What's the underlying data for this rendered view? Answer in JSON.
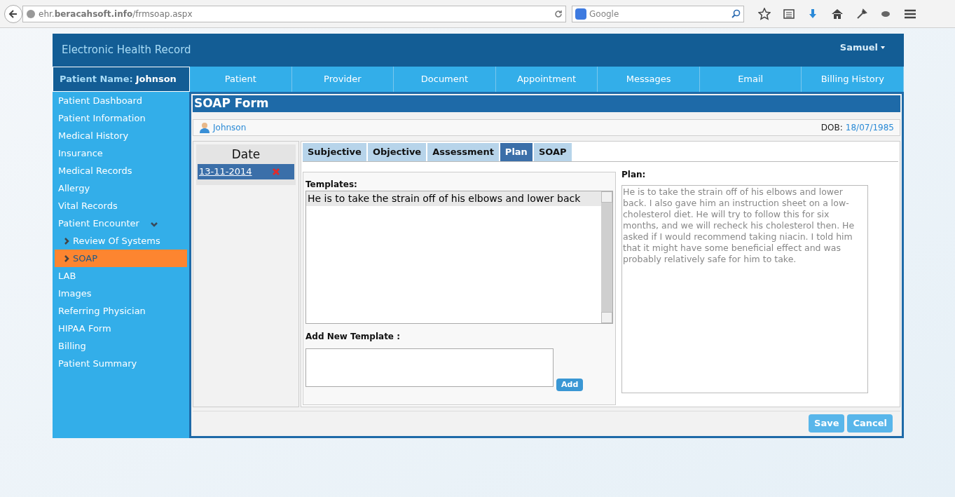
{
  "browser": {
    "url": "ehr.**beracahsoft.info**/frmsoap.aspx",
    "search_placeholder": "Google"
  },
  "header": {
    "title": "Electronic Health Record",
    "user": "Samuel"
  },
  "nav": {
    "patient_label": "Patient Name:",
    "patient_name": "Johnson",
    "tabs": [
      {
        "label": "Patient",
        "selected": false
      },
      {
        "label": "Provider",
        "selected": false
      },
      {
        "label": "Document",
        "selected": false
      },
      {
        "label": "Appointment",
        "selected": false
      },
      {
        "label": "Messages",
        "selected": false
      },
      {
        "label": "Email",
        "selected": false
      },
      {
        "label": "Billing History",
        "selected": false
      }
    ]
  },
  "sidebar": {
    "items": [
      {
        "label": "Patient Dashboard",
        "selected": false
      },
      {
        "label": "Patient Information",
        "selected": false
      },
      {
        "label": "Medical History",
        "selected": false
      },
      {
        "label": "Insurance",
        "selected": false
      },
      {
        "label": "Medical Records",
        "selected": false
      },
      {
        "label": "Allergy",
        "selected": false
      },
      {
        "label": "Vital Records",
        "selected": false
      },
      {
        "label": "Patient Encounter",
        "selected": false,
        "expanded": true,
        "children": [
          {
            "label": "Review Of Systems",
            "selected": false
          },
          {
            "label": "SOAP",
            "selected": true
          }
        ]
      },
      {
        "label": "LAB",
        "selected": false
      },
      {
        "label": "Images",
        "selected": false
      },
      {
        "label": "Referring Physician",
        "selected": false
      },
      {
        "label": "HIPAA Form",
        "selected": false
      },
      {
        "label": "Billing",
        "selected": false
      },
      {
        "label": "Patient Summary",
        "selected": false
      }
    ]
  },
  "form": {
    "title": "SOAP Form",
    "patient": "Johnson",
    "dob_label": "DOB:",
    "dob": "18/07/1985",
    "date_header": "Date",
    "dates": [
      {
        "date": "13-11-2014",
        "selected": true
      }
    ],
    "tabs": [
      {
        "label": "Subjective",
        "selected": false
      },
      {
        "label": "Objective",
        "selected": false
      },
      {
        "label": "Assessment",
        "selected": false
      },
      {
        "label": "Plan",
        "selected": true
      },
      {
        "label": "SOAP",
        "selected": false
      }
    ],
    "templates_label": "Templates:",
    "templates": [
      {
        "text": "He is to take the strain off of his elbows and lower back",
        "selected": true
      }
    ],
    "add_label": "Add New Template :",
    "add_button": "Add",
    "plan_label": "Plan:",
    "plan_text": "He is to take the strain off of his elbows and lower back. I also gave him an instruction sheet on a low-cholesterol diet. He will try to follow this for six months, and we will recheck his cholesterol then. He asked if I would recommend taking niacin. I told him that it might have some beneficial effect and was probably relatively safe for him to take.",
    "buttons": [
      "Save",
      "Cancel"
    ]
  }
}
